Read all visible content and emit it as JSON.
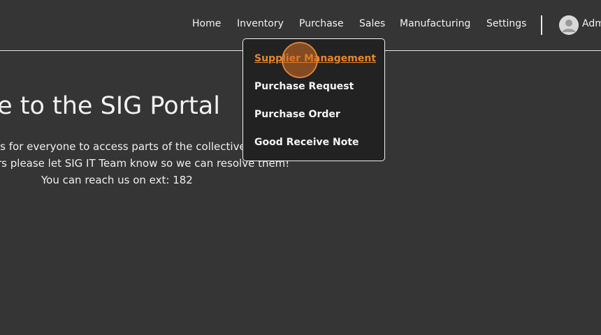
{
  "nav": {
    "items": [
      {
        "label": "Home"
      },
      {
        "label": "Inventory"
      },
      {
        "label": "Purchase"
      },
      {
        "label": "Sales"
      },
      {
        "label": "Manufacturing"
      },
      {
        "label": "Settings"
      }
    ],
    "user": {
      "name": "Adm"
    }
  },
  "welcome": {
    "title": "me to the SIG Portal",
    "lines": [
      "is for everyone to access parts of the collective",
      "rs please let SIG IT Team know so we can resolve them!",
      "You can reach us on ext: 182"
    ]
  },
  "dropdown": {
    "items": [
      {
        "label": "Supplier Management",
        "active": true
      },
      {
        "label": "Purchase Request"
      },
      {
        "label": "Purchase Order"
      },
      {
        "label": "Good Receive Note"
      }
    ]
  },
  "colors": {
    "background": "#353535",
    "dropdown_bg": "#222222",
    "accent": "#e8852b"
  },
  "icons": {
    "avatar": "user-avatar-icon"
  }
}
